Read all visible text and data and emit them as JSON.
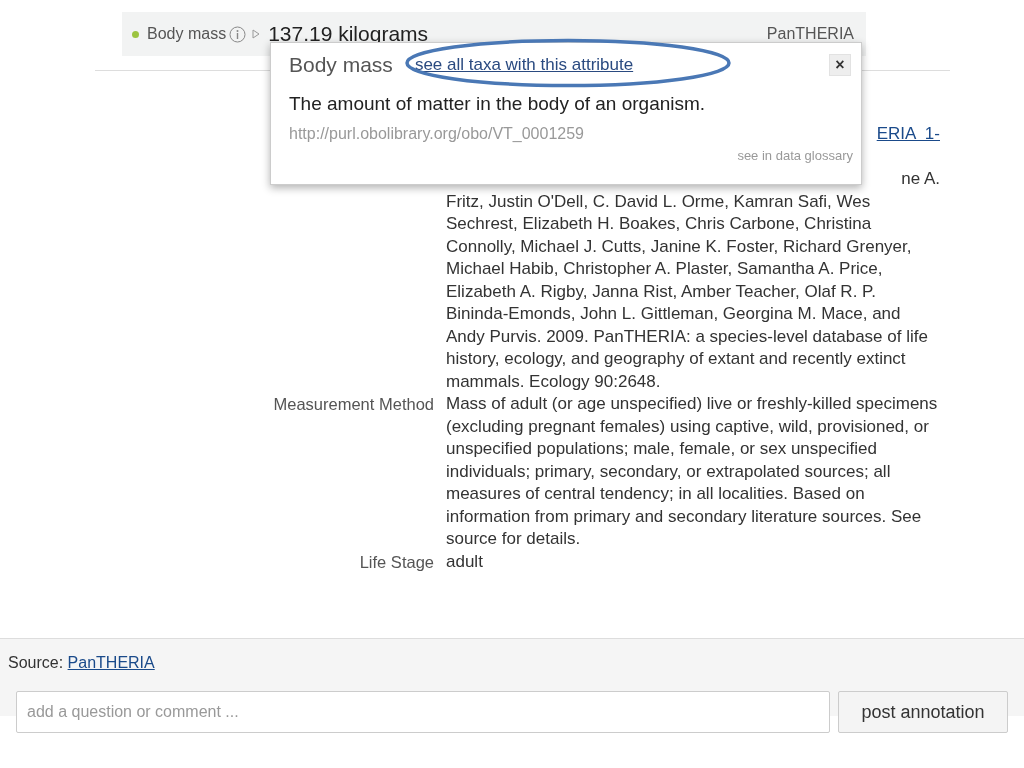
{
  "trait_row": {
    "attribute": "Body mass",
    "value": "137.19 kilograms",
    "source": "PanTHERIA"
  },
  "popover": {
    "title": "Body mass",
    "link": "see all taxa with this attribute",
    "close": "×",
    "definition": "The amount of matter in the body of an organism.",
    "uri": "http://purl.obolibrary.org/obo/VT_0001259",
    "glossary_link": "see in data glossary"
  },
  "metadata": [
    {
      "kind": "partial",
      "fragments": [
        {
          "text": "ERIA  1-",
          "link": true
        },
        {
          "text": "ne A.",
          "link": false
        }
      ],
      "value": "Fritz, Justin O'Dell, C. David L. Orme, Kamran Safi, Wes Sechrest, Elizabeth H. Boakes, Chris Carbone, Christina Connolly, Michael J. Cutts, Janine K. Foster, Richard Grenyer, Michael Habib, Christopher A. Plaster, Samantha A. Price, Elizabeth A. Rigby, Janna Rist, Amber Teacher, Olaf R. P. Bininda-Emonds, John L. Gittleman, Georgina M. Mace, and Andy Purvis. 2009. PanTHERIA: a species-level database of life history, ecology, and geography of extant and recently extinct mammals. Ecology 90:2648."
    },
    {
      "kind": "row",
      "label": "Measurement Method",
      "value": "Mass of adult (or age unspecified) live or freshly-killed specimens (excluding pregnant females) using captive, wild, provisioned, or unspecified populations; male, female, or sex unspecified individuals; primary, secondary, or extrapolated sources; all measures of central tendency; in all localities. Based on information from primary and secondary literature sources. See source for details."
    },
    {
      "kind": "row",
      "label": "Life Stage",
      "value": "adult"
    }
  ],
  "footer": {
    "source_label": "Source:",
    "source_link": "PanTHERIA",
    "comment_placeholder": "add a question or comment ...",
    "post_button": "post annotation"
  }
}
